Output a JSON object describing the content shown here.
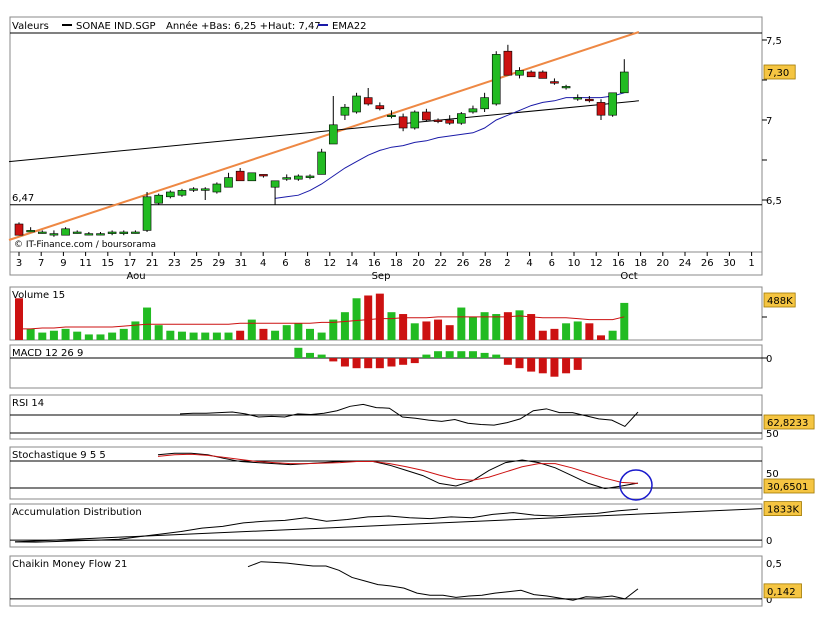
{
  "header": {
    "label": "Valeurs",
    "ticker": "SONAE IND.SGP",
    "range_info": "Année +Bas: 6,25 +Haut: 7,47",
    "ema_label": "EMA22"
  },
  "watermark": "© IT-Finance.com / boursorama",
  "colors": {
    "up": "#22bb22",
    "down": "#cc1111",
    "ema": "#1a1aa8",
    "trend": "#ee8844",
    "badge": "#f5c542"
  },
  "chart_data": [
    {
      "type": "candlestick",
      "title": "SONAE IND.SGP",
      "ylim": [
        6.25,
        7.55
      ],
      "yticks": [
        "7,5",
        "7",
        "6,5"
      ],
      "ytick_values": [
        7.5,
        7.0,
        6.5
      ],
      "hline": {
        "value": 6.47,
        "label": "6,47"
      },
      "last_value_badge": "7,30",
      "last_value": 7.3,
      "xtick_labels": [
        "3",
        "7",
        "9",
        "11",
        "15",
        "17",
        "21",
        "23",
        "25",
        "29",
        "31",
        "4",
        "6",
        "8",
        "12",
        "14",
        "16",
        "18",
        "20",
        "22",
        "26",
        "28",
        "2",
        "4",
        "6",
        "10",
        "12",
        "16",
        "18",
        "20",
        "24",
        "26",
        "30",
        "1"
      ],
      "month_labels": [
        "Aou",
        "Sep",
        "Oct"
      ],
      "candles": [
        {
          "o": 6.35,
          "h": 6.36,
          "l": 6.28,
          "c": 6.28
        },
        {
          "o": 6.31,
          "h": 6.33,
          "l": 6.3,
          "c": 6.31
        },
        {
          "o": 6.3,
          "h": 6.31,
          "l": 6.29,
          "c": 6.3
        },
        {
          "o": 6.29,
          "h": 6.31,
          "l": 6.27,
          "c": 6.29
        },
        {
          "o": 6.28,
          "h": 6.33,
          "l": 6.28,
          "c": 6.32
        },
        {
          "o": 6.3,
          "h": 6.31,
          "l": 6.29,
          "c": 6.3
        },
        {
          "o": 6.29,
          "h": 6.3,
          "l": 6.28,
          "c": 6.29
        },
        {
          "o": 6.29,
          "h": 6.3,
          "l": 6.28,
          "c": 6.29
        },
        {
          "o": 6.29,
          "h": 6.31,
          "l": 6.28,
          "c": 6.3
        },
        {
          "o": 6.29,
          "h": 6.31,
          "l": 6.28,
          "c": 6.3
        },
        {
          "o": 6.3,
          "h": 6.31,
          "l": 6.29,
          "c": 6.3
        },
        {
          "o": 6.31,
          "h": 6.55,
          "l": 6.3,
          "c": 6.52
        },
        {
          "o": 6.48,
          "h": 6.54,
          "l": 6.47,
          "c": 6.53
        },
        {
          "o": 6.52,
          "h": 6.56,
          "l": 6.51,
          "c": 6.55
        },
        {
          "o": 6.53,
          "h": 6.57,
          "l": 6.52,
          "c": 6.56
        },
        {
          "o": 6.57,
          "h": 6.58,
          "l": 6.55,
          "c": 6.57
        },
        {
          "o": 6.56,
          "h": 6.58,
          "l": 6.5,
          "c": 6.57
        },
        {
          "o": 6.55,
          "h": 6.61,
          "l": 6.54,
          "c": 6.6
        },
        {
          "o": 6.58,
          "h": 6.67,
          "l": 6.58,
          "c": 6.64
        },
        {
          "o": 6.68,
          "h": 6.7,
          "l": 6.62,
          "c": 6.62
        },
        {
          "o": 6.62,
          "h": 6.67,
          "l": 6.62,
          "c": 6.67
        },
        {
          "o": 6.66,
          "h": 6.66,
          "l": 6.64,
          "c": 6.65
        },
        {
          "o": 6.58,
          "h": 6.62,
          "l": 6.47,
          "c": 6.62
        },
        {
          "o": 6.63,
          "h": 6.66,
          "l": 6.62,
          "c": 6.64
        },
        {
          "o": 6.63,
          "h": 6.66,
          "l": 6.62,
          "c": 6.65
        },
        {
          "o": 6.64,
          "h": 6.66,
          "l": 6.63,
          "c": 6.65
        },
        {
          "o": 6.66,
          "h": 6.82,
          "l": 6.66,
          "c": 6.8
        },
        {
          "o": 6.85,
          "h": 7.15,
          "l": 6.85,
          "c": 6.97
        },
        {
          "o": 7.03,
          "h": 7.1,
          "l": 7.0,
          "c": 7.08
        },
        {
          "o": 7.05,
          "h": 7.17,
          "l": 7.04,
          "c": 7.15
        },
        {
          "o": 7.14,
          "h": 7.2,
          "l": 7.09,
          "c": 7.1
        },
        {
          "o": 7.09,
          "h": 7.11,
          "l": 7.06,
          "c": 7.07
        },
        {
          "o": 7.03,
          "h": 7.06,
          "l": 7.01,
          "c": 7.03
        },
        {
          "o": 7.02,
          "h": 7.04,
          "l": 6.93,
          "c": 6.95
        },
        {
          "o": 6.95,
          "h": 7.06,
          "l": 6.94,
          "c": 7.05
        },
        {
          "o": 7.05,
          "h": 7.07,
          "l": 6.99,
          "c": 7.0
        },
        {
          "o": 7.0,
          "h": 7.01,
          "l": 6.98,
          "c": 6.99
        },
        {
          "o": 7.0,
          "h": 7.03,
          "l": 6.97,
          "c": 6.98
        },
        {
          "o": 6.98,
          "h": 7.05,
          "l": 6.97,
          "c": 7.04
        },
        {
          "o": 7.05,
          "h": 7.09,
          "l": 7.04,
          "c": 7.07
        },
        {
          "o": 7.07,
          "h": 7.17,
          "l": 7.05,
          "c": 7.14
        },
        {
          "o": 7.1,
          "h": 7.43,
          "l": 7.09,
          "c": 7.41
        },
        {
          "o": 7.43,
          "h": 7.47,
          "l": 7.28,
          "c": 7.28
        },
        {
          "o": 7.28,
          "h": 7.33,
          "l": 7.26,
          "c": 7.31
        },
        {
          "o": 7.3,
          "h": 7.31,
          "l": 7.27,
          "c": 7.27
        },
        {
          "o": 7.3,
          "h": 7.31,
          "l": 7.26,
          "c": 7.26
        },
        {
          "o": 7.24,
          "h": 7.26,
          "l": 7.22,
          "c": 7.23
        },
        {
          "o": 7.21,
          "h": 7.22,
          "l": 7.19,
          "c": 7.21
        },
        {
          "o": 7.14,
          "h": 7.16,
          "l": 7.12,
          "c": 7.14
        },
        {
          "o": 7.13,
          "h": 7.15,
          "l": 7.11,
          "c": 7.12
        },
        {
          "o": 7.11,
          "h": 7.13,
          "l": 7.0,
          "c": 7.03
        },
        {
          "o": 7.03,
          "h": 7.17,
          "l": 7.02,
          "c": 7.17
        },
        {
          "o": 7.17,
          "h": 7.38,
          "l": 7.17,
          "c": 7.3
        }
      ],
      "ema22": [
        6.3,
        6.3,
        6.3,
        6.3,
        6.3,
        6.3,
        6.3,
        6.3,
        6.3,
        6.3,
        6.3,
        6.3,
        6.3,
        6.3,
        6.3,
        6.3,
        6.3,
        6.3,
        6.3,
        6.3,
        6.3,
        6.3,
        6.51,
        6.52,
        6.53,
        6.56,
        6.6,
        6.65,
        6.7,
        6.74,
        6.78,
        6.81,
        6.83,
        6.84,
        6.86,
        6.87,
        6.89,
        6.9,
        6.91,
        6.92,
        6.95,
        7.0,
        7.03,
        7.06,
        7.09,
        7.11,
        7.12,
        7.14,
        7.14,
        7.14,
        7.14,
        7.15,
        7.17
      ],
      "trendlines": [
        {
          "name": "support",
          "from": [
            0,
            6.25
          ],
          "to": [
            53,
            7.55
          ],
          "color": "orange"
        },
        {
          "name": "long",
          "from": [
            0,
            6.74
          ],
          "to": [
            53,
            7.12
          ],
          "color": "black"
        }
      ]
    },
    {
      "type": "bar",
      "title": "Volume 15",
      "last_value_badge": "488K",
      "values": [
        45,
        12,
        8,
        10,
        12,
        9,
        6,
        6,
        8,
        12,
        20,
        35,
        16,
        10,
        9,
        8,
        8,
        8,
        8,
        10,
        22,
        12,
        10,
        16,
        18,
        12,
        8,
        22,
        30,
        45,
        48,
        50,
        30,
        28,
        18,
        20,
        22,
        16,
        35,
        25,
        30,
        28,
        30,
        32,
        28,
        10,
        12,
        18,
        20,
        18,
        5,
        10,
        40
      ],
      "series_ma": [
        12,
        12,
        13,
        13,
        14,
        14,
        14,
        14,
        14,
        15,
        16,
        17,
        17,
        17,
        17,
        17,
        17,
        17,
        17,
        18,
        18,
        18,
        18,
        18,
        18,
        18,
        19,
        19,
        20,
        21,
        22,
        23,
        23,
        24,
        24,
        24,
        25,
        25,
        25,
        25,
        25,
        25,
        25,
        26,
        25,
        24,
        24,
        24,
        23,
        22,
        22,
        22,
        25
      ],
      "ylim": [
        0,
        55
      ]
    },
    {
      "type": "bar",
      "title": "MACD 12 26 9",
      "yticks": [
        "0"
      ],
      "values": [
        0,
        0,
        0,
        0,
        0,
        0,
        0,
        0,
        0,
        0,
        0,
        0,
        0,
        0,
        0,
        0,
        0,
        0,
        0,
        0,
        0,
        0,
        0,
        0,
        0,
        0,
        0,
        0,
        0,
        0,
        0,
        0,
        0,
        0,
        3,
        1.5,
        1,
        -1,
        -2.5,
        -3,
        -3,
        -3,
        -2.5,
        -2,
        -1.5,
        1,
        2,
        2,
        2,
        2,
        1.5,
        1,
        -2,
        -3,
        -4,
        -4.5,
        -5.5,
        -4.5,
        -3.5
      ],
      "ylim": [
        -5,
        4
      ]
    },
    {
      "type": "line",
      "title": "RSI 14",
      "last_value_badge": "62,8233",
      "yticks": [
        "50"
      ],
      "ylim": [
        20,
        90
      ],
      "values": [
        60,
        61,
        61,
        62,
        63,
        60,
        55,
        56,
        55,
        60,
        59,
        61,
        65,
        72,
        75,
        70,
        69,
        55,
        53,
        50,
        48,
        51,
        45,
        43,
        42,
        46,
        52,
        65,
        68,
        62,
        62,
        57,
        52,
        50,
        40,
        62.8
      ]
    },
    {
      "type": "line",
      "title": "Stochastique 9 5 5",
      "last_value_badge": "30,6501",
      "yticks": [
        "50"
      ],
      "ylim": [
        0,
        100
      ],
      "series": [
        {
          "values": [
            85,
            88,
            88,
            85,
            78,
            72,
            70,
            68,
            66,
            68,
            70,
            72,
            73,
            72,
            65,
            55,
            45,
            30,
            25,
            35,
            55,
            70,
            75,
            70,
            60,
            45,
            30,
            20,
            25,
            30.6
          ]
        },
        {
          "values": [
            82,
            85,
            86,
            84,
            80,
            76,
            72,
            70,
            68,
            68,
            69,
            70,
            72,
            72,
            68,
            62,
            55,
            46,
            38,
            36,
            42,
            52,
            62,
            68,
            68,
            60,
            50,
            40,
            32,
            30
          ]
        }
      ]
    },
    {
      "type": "line",
      "title": "Accumulation Distribution",
      "last_value_badge": "1833K",
      "yticks": [
        "0"
      ],
      "ylim": [
        -400,
        2100
      ],
      "values": [
        -100,
        -120,
        -80,
        -40,
        0,
        50,
        200,
        350,
        500,
        700,
        800,
        1000,
        1100,
        1150,
        1300,
        1100,
        1200,
        1350,
        1400,
        1300,
        1250,
        1350,
        1300,
        1500,
        1600,
        1450,
        1400,
        1500,
        1550,
        1700,
        1800
      ],
      "trendline": [
        [
          0,
          -100
        ],
        [
          53,
          1833
        ]
      ]
    },
    {
      "type": "line",
      "title": "Chaikin Money Flow 21",
      "last_value_badge": "0,142",
      "yticks": [
        "0,5",
        "0"
      ],
      "ylim": [
        -0.1,
        0.6
      ],
      "values": [
        0.45,
        0.52,
        0.51,
        0.5,
        0.48,
        0.46,
        0.46,
        0.4,
        0.3,
        0.25,
        0.2,
        0.18,
        0.15,
        0.08,
        0.05,
        0.05,
        0.02,
        0.04,
        0.05,
        0.08,
        0.1,
        0.12,
        0.06,
        0.04,
        0.01,
        -0.02,
        0.03,
        0.02,
        0.04,
        0.0,
        0.14
      ]
    }
  ]
}
